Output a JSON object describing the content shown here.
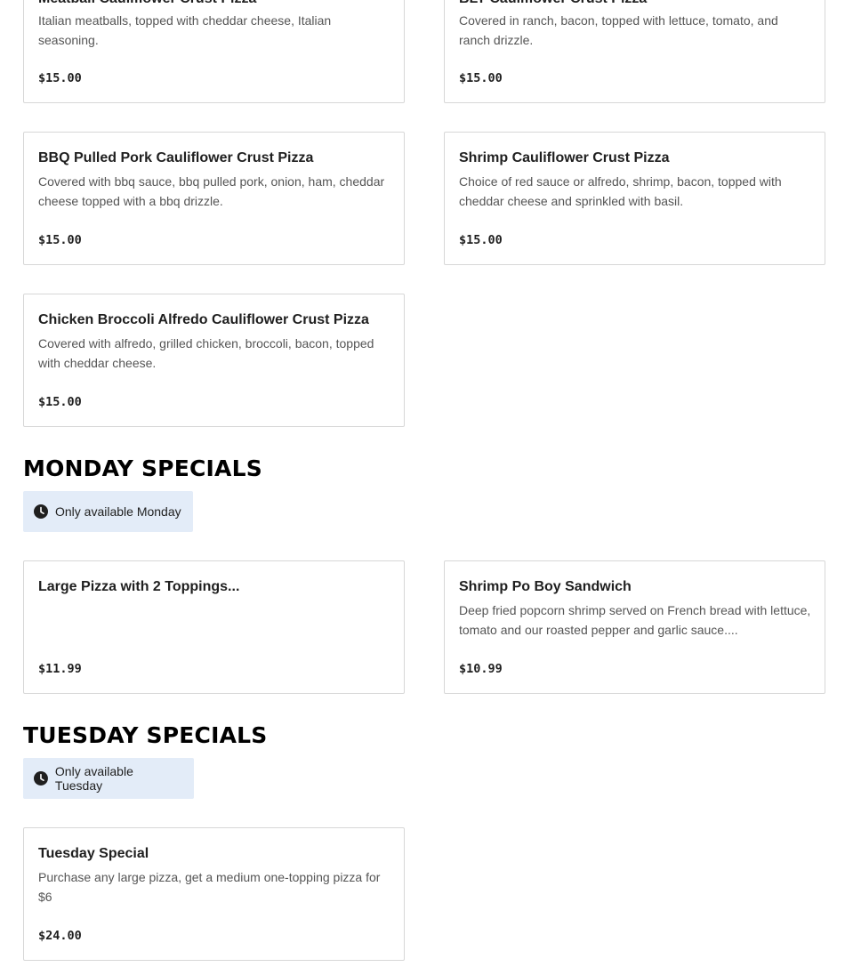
{
  "pizza_section": {
    "items": [
      {
        "name": "Meatball Cauliflower Crust Pizza",
        "description": "Italian meatballs, topped with cheddar cheese, Italian seasoning.",
        "price": "$15.00"
      },
      {
        "name": "BLT Cauliflower Crust Pizza",
        "description": "Covered in ranch, bacon, topped with lettuce, tomato, and ranch drizzle.",
        "price": "$15.00"
      },
      {
        "name": "BBQ Pulled Pork Cauliflower Crust Pizza",
        "description": "Covered with bbq sauce, bbq pulled pork, onion, ham, cheddar cheese topped with a bbq drizzle.",
        "price": "$15.00"
      },
      {
        "name": "Shrimp Cauliflower Crust Pizza",
        "description": "Choice of red sauce or alfredo, shrimp, bacon, topped with cheddar cheese and sprinkled with basil.",
        "price": "$15.00"
      },
      {
        "name": "Chicken Broccoli Alfredo Cauliflower Crust Pizza",
        "description": "Covered with alfredo, grilled chicken, broccoli, bacon, topped with cheddar cheese.",
        "price": "$15.00"
      }
    ]
  },
  "monday_section": {
    "title": "MONDAY SPECIALS",
    "availability": "Only available Monday",
    "items": [
      {
        "name": "Large Pizza with 2 Toppings...",
        "description": "",
        "price": "$11.99"
      },
      {
        "name": "Shrimp Po Boy Sandwich",
        "description": "Deep fried popcorn shrimp served on French bread with lettuce, tomato and our roasted pepper and garlic sauce....",
        "price": "$10.99"
      }
    ]
  },
  "tuesday_section": {
    "title": "TUESDAY SPECIALS",
    "availability": "Only available Tuesday",
    "items": [
      {
        "name": "Tuesday Special",
        "description": "Purchase any large pizza, get a medium one-topping pizza for $6",
        "price": "$24.00"
      }
    ]
  },
  "icons": {
    "availability_icon": "clock-icon"
  },
  "colors": {
    "badge_background": "#e3ecf8",
    "card_border": "#d7d7d7",
    "description_text": "#555555"
  }
}
